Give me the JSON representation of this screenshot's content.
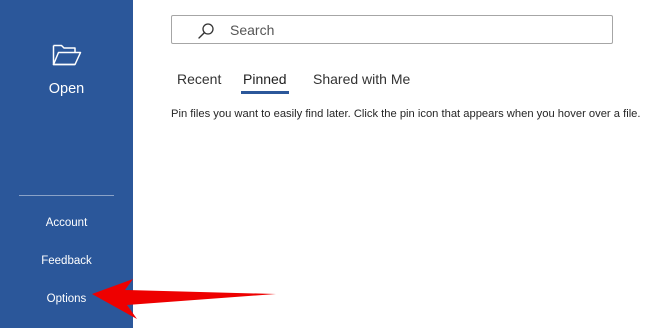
{
  "sidebar": {
    "open_label": "Open",
    "items": [
      {
        "label": "Account"
      },
      {
        "label": "Feedback"
      },
      {
        "label": "Options"
      }
    ]
  },
  "search": {
    "placeholder": "Search",
    "value": ""
  },
  "tabs": [
    {
      "label": "Recent",
      "selected": false
    },
    {
      "label": "Pinned",
      "selected": true
    },
    {
      "label": "Shared with Me",
      "selected": false
    }
  ],
  "pinned_message": "Pin files you want to easily find later. Click the pin icon that appears when you hover over a file.",
  "annotation": {
    "icon": "arrow-left",
    "color": "#ee0000"
  },
  "colors": {
    "sidebar_bg": "#2b579a",
    "tab_underline": "#2b579a",
    "arrow": "#ee0000"
  }
}
